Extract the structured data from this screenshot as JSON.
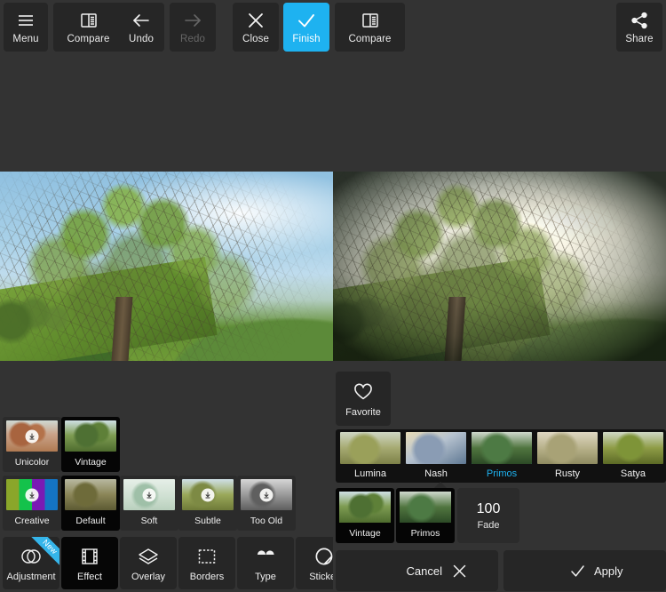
{
  "toolbar": {
    "buttons": [
      {
        "label": "Menu",
        "icon": "hamburger-menu-icon",
        "state": "normal"
      },
      {
        "label": "Compare",
        "icon": "compare-panel-icon",
        "state": "normal"
      },
      {
        "label": "Undo",
        "icon": "arrow-left-icon",
        "state": "normal"
      },
      {
        "label": "Redo",
        "icon": "arrow-right-icon",
        "state": "disabled"
      },
      {
        "label": "Close",
        "icon": "close-x-icon",
        "state": "normal"
      },
      {
        "label": "Finish",
        "icon": "check-icon",
        "state": "active"
      },
      {
        "label": "Compare",
        "icon": "compare-panel-icon",
        "state": "normal"
      },
      {
        "label": "Share",
        "icon": "share-nodes-icon",
        "state": "normal"
      }
    ]
  },
  "preview": {
    "original_label": "original-photo",
    "filtered_label": "filtered-photo"
  },
  "presets": {
    "row1": [
      {
        "name": "Unicolor",
        "thumb": "th-unicolor",
        "download": true,
        "selected": false
      },
      {
        "name": "Vintage",
        "thumb": "th-vintage",
        "download": false,
        "selected": true
      }
    ],
    "row2": [
      {
        "name": "Creative",
        "thumb": "th-creative",
        "download": true,
        "selected": false
      },
      {
        "name": "Default",
        "thumb": "th-default",
        "download": false,
        "selected": true
      },
      {
        "name": "Soft",
        "thumb": "th-soft",
        "download": true,
        "selected": false
      },
      {
        "name": "Subtle",
        "thumb": "th-subtle",
        "download": true,
        "selected": false
      },
      {
        "name": "Too Old",
        "thumb": "th-tooold",
        "download": true,
        "selected": false
      }
    ]
  },
  "bottom_tools": [
    {
      "label": "Adjustment",
      "icon": "adjustment-circles-icon",
      "badge": "New",
      "selected": false
    },
    {
      "label": "Effect",
      "icon": "film-strip-icon",
      "badge": "",
      "selected": true
    },
    {
      "label": "Overlay",
      "icon": "layers-icon",
      "badge": "",
      "selected": false
    },
    {
      "label": "Borders",
      "icon": "frame-icon",
      "badge": "",
      "selected": false
    },
    {
      "label": "Type",
      "icon": "quote-marks-icon",
      "badge": "",
      "selected": false
    },
    {
      "label": "Sticker",
      "icon": "circle-sticker-icon",
      "badge": "",
      "selected": false
    }
  ],
  "right_panel": {
    "favorite": {
      "label": "Favorite",
      "icon": "heart-outline-icon"
    },
    "effects": [
      {
        "name": "Lumina",
        "thumb": "th-lumina",
        "selected": false
      },
      {
        "name": "Nash",
        "thumb": "th-nash",
        "selected": false
      },
      {
        "name": "Primos",
        "thumb": "th-primos",
        "selected": true
      },
      {
        "name": "Rusty",
        "thumb": "th-rusty",
        "selected": false
      },
      {
        "name": "Satya",
        "thumb": "th-satya",
        "selected": false
      }
    ],
    "applied": [
      {
        "name": "Vintage",
        "thumb": "th-vintage"
      },
      {
        "name": "Primos",
        "thumb": "th-primos"
      }
    ],
    "fade": {
      "value": "100",
      "label": "Fade"
    },
    "actions": {
      "cancel": {
        "label": "Cancel",
        "icon": "close-x-icon"
      },
      "apply": {
        "label": "Apply",
        "icon": "check-icon"
      }
    }
  },
  "colors": {
    "accent": "#1eb2f0",
    "background": "#333333",
    "button": "#262626",
    "selected": "#050505",
    "badge": "#35b5ea"
  }
}
